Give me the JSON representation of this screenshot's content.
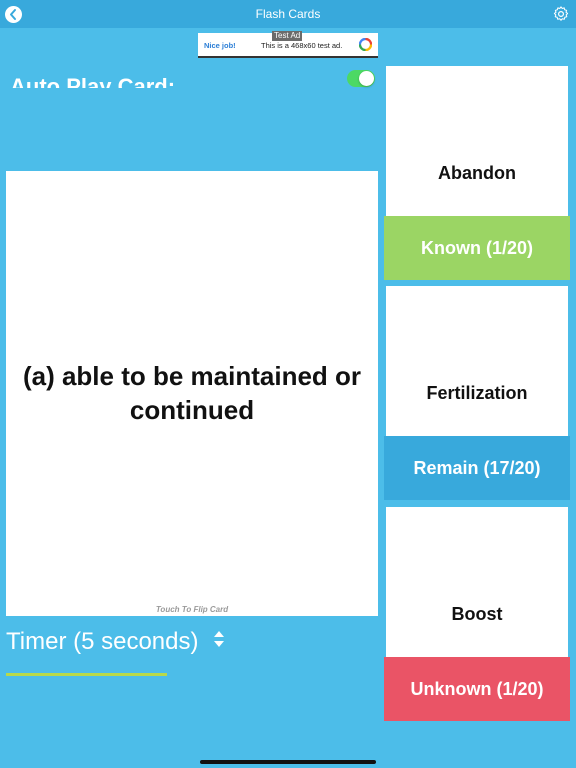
{
  "header": {
    "title": "Flash Cards",
    "back_icon": "chevron-left-icon",
    "settings_icon": "gear-icon"
  },
  "ad": {
    "tag": "Test Ad",
    "nice": "Nice job!",
    "text": "This is a 468x60 test ad."
  },
  "autoplay": {
    "label": "Auto Play Card:",
    "enabled": true
  },
  "card": {
    "definition": "(a) able to be maintained or continued",
    "hint": "Touch To Flip Card"
  },
  "timer": {
    "label": "Timer (5 seconds)"
  },
  "stacks": [
    {
      "word": "Abandon",
      "button": "Known (1/20)",
      "color": "#9bd564"
    },
    {
      "word": "Fertilization",
      "button": "Remain (17/20)",
      "color": "#38a9dc"
    },
    {
      "word": "Boost",
      "button": "Unknown (1/20)",
      "color": "#ea5466"
    }
  ],
  "colors": {
    "background": "#4cbde9",
    "header": "#38a9dc",
    "toggle": "#4cd964",
    "timer_line": "#b7d94a"
  }
}
